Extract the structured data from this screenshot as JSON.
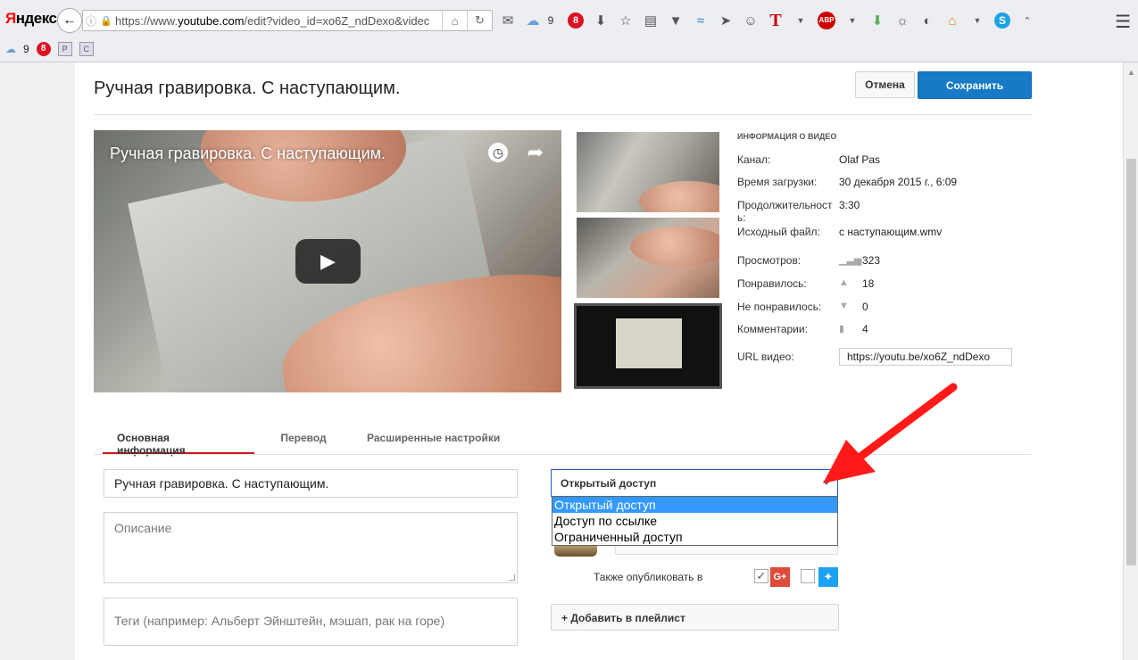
{
  "browser": {
    "brand_ya": "Я",
    "brand_rest": "ндекс",
    "url_prefix": "https://www.",
    "url_domain": "youtube.com",
    "url_rest": "/edit?video_id=xo6Z_ndDexo&videc",
    "cloud_count": "9",
    "mail_badge": "8",
    "bookmark_cloud_count": "9",
    "bookmark_badge": "8",
    "bookmark_p": "P",
    "bookmark_c": "C",
    "abp_label": "ABP",
    "t_label": "T",
    "skype_label": "S"
  },
  "header": {
    "title": "Ручная гравировка. С наступающим.",
    "cancel_label": "Отмена",
    "save_label": "Сохранить"
  },
  "player": {
    "title": "Ручная гравировка. С наступающим."
  },
  "info": {
    "heading": "ИНФОРМАЦИЯ О ВИДЕО",
    "channel_label": "Канал:",
    "channel_value": "Olaf Pas",
    "upload_label": "Время загрузки:",
    "upload_value": "30 декабря 2015 г., 6:09",
    "duration_label": "Продолжительность:",
    "duration_value": "3:30",
    "source_label": "Исходный файл:",
    "source_value": "с наступающим.wmv",
    "views_label": "Просмотров:",
    "views_value": "323",
    "likes_label": "Понравилось:",
    "likes_value": "18",
    "dislikes_label": "Не понравилось:",
    "dislikes_value": "0",
    "comments_label": "Комментарии:",
    "comments_value": "4",
    "url_label": "URL видео:",
    "url_value": "https://youtu.be/xo6Z_ndDexo"
  },
  "tabs": [
    {
      "label": "Основная информация"
    },
    {
      "label": "Перевод"
    },
    {
      "label": "Расширенные настройки"
    }
  ],
  "form": {
    "title_value": "Ручная гравировка. С наступающим.",
    "description_placeholder": "Описание",
    "tags_placeholder": "Теги (например: Альберт Эйнштейн, мэшап, рак на горе)",
    "privacy_selected": "Открытый доступ",
    "privacy_options": [
      "Открытый доступ",
      "Доступ по ссылке",
      "Ограниченный доступ"
    ],
    "also_publish_label": "Также опубликовать в",
    "gplus_label": "G+",
    "add_playlist_label": "+ Добавить в плейлист"
  },
  "colors": {
    "save_blue": "#167ac6",
    "tab_active_red": "#cc181e",
    "dropdown_highlight": "#3399ff",
    "annotation_arrow": "#ff1a1a"
  }
}
